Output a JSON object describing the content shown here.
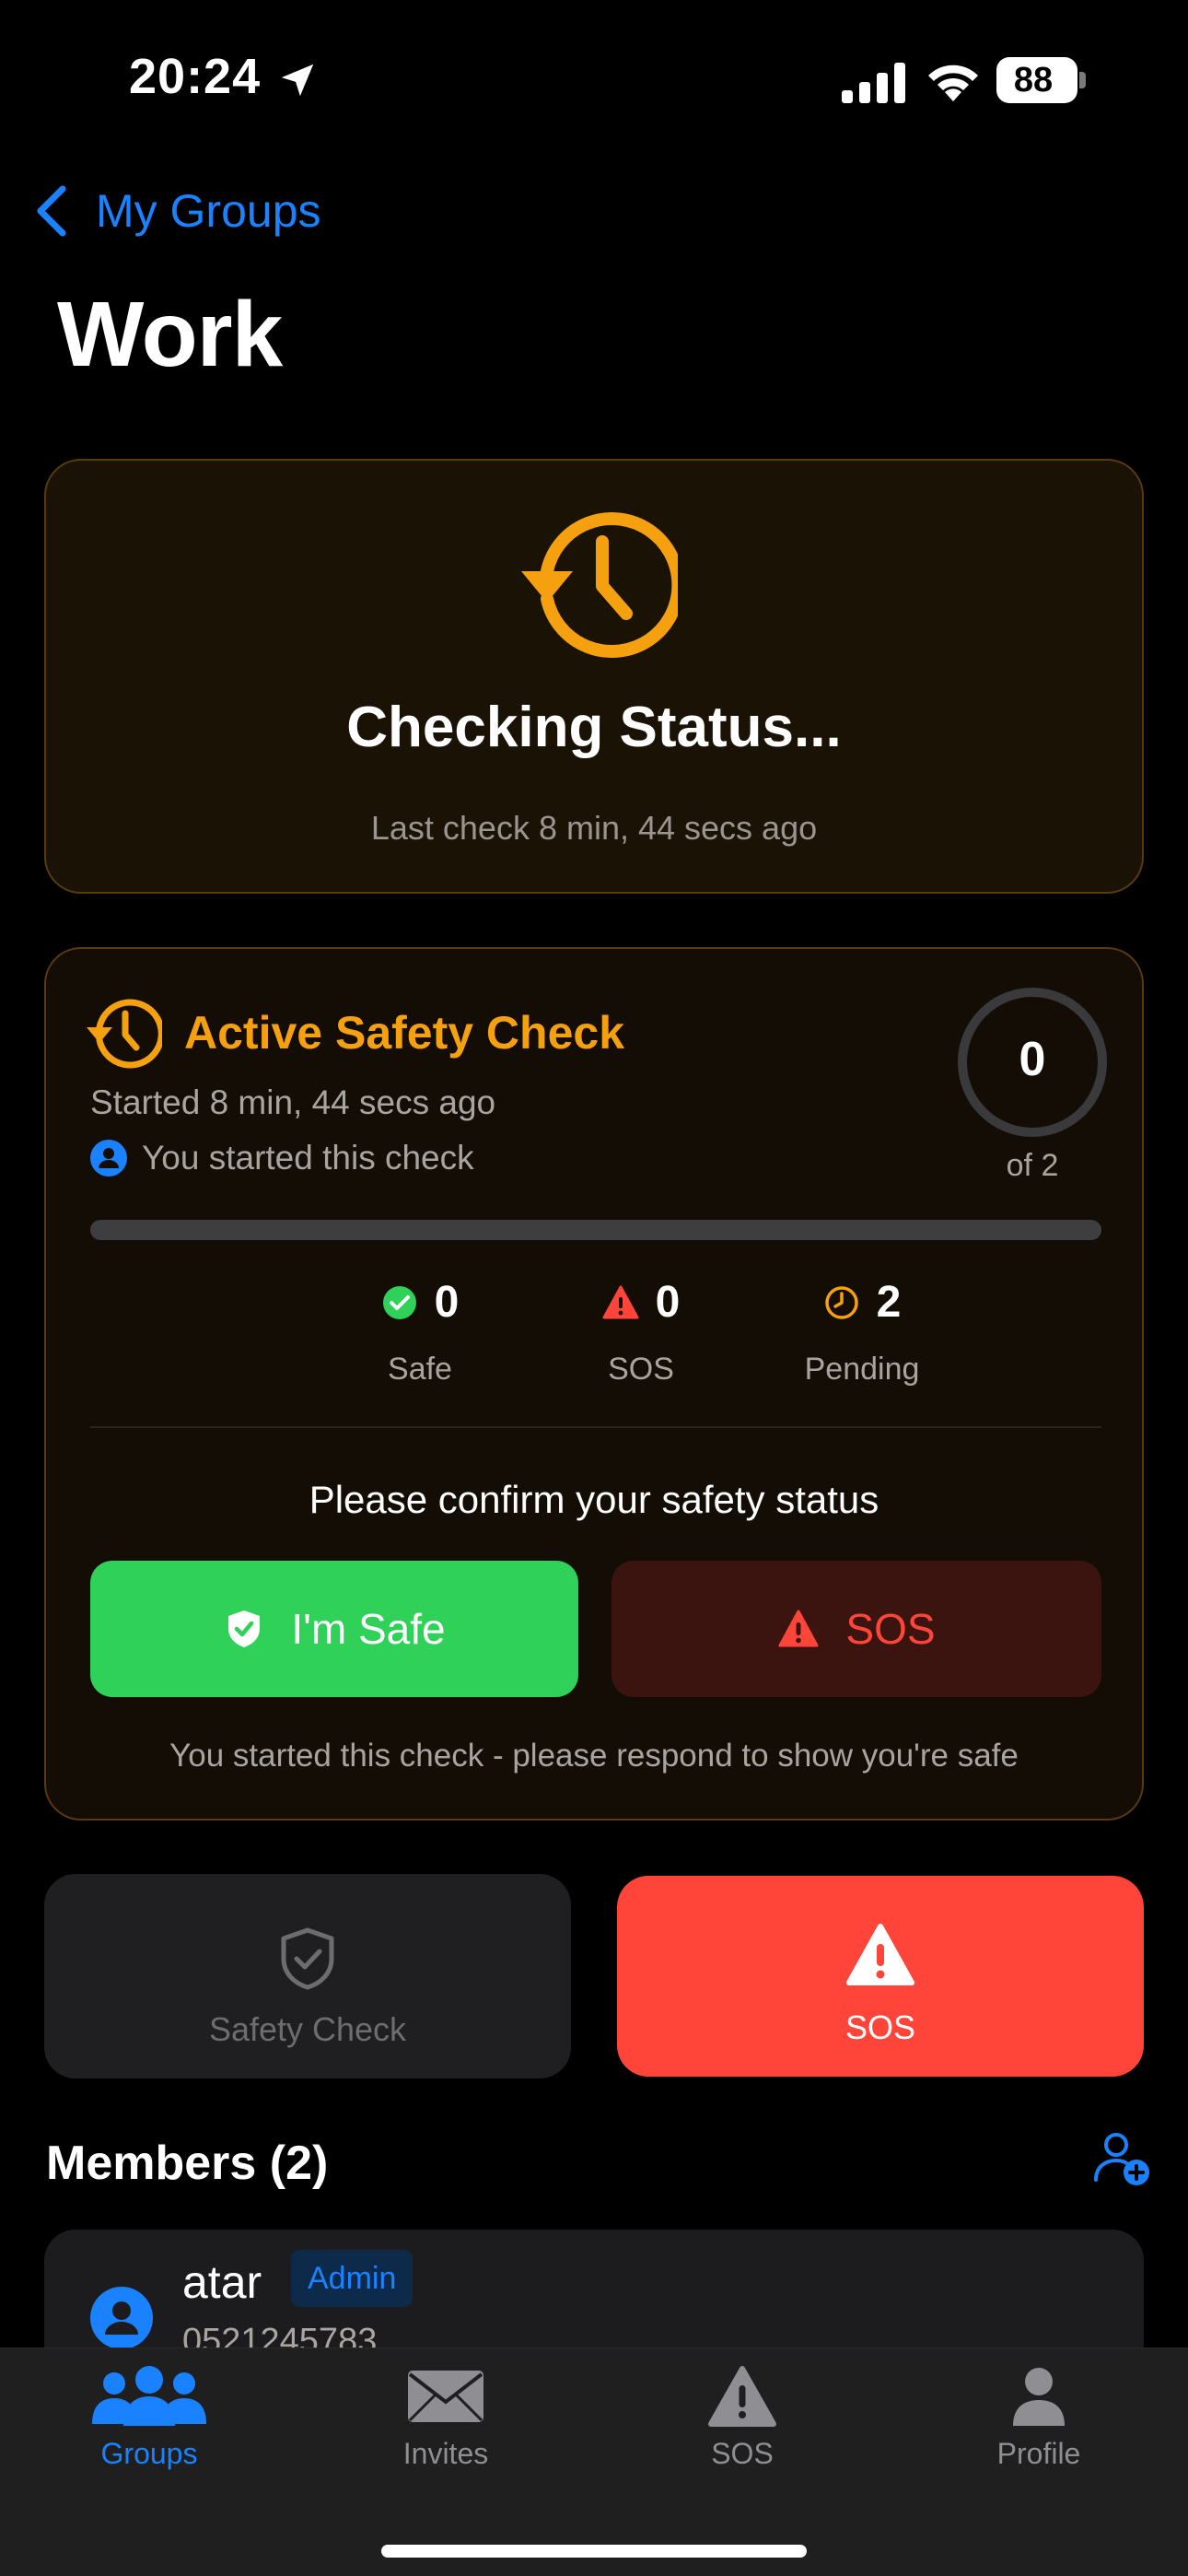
{
  "status_bar": {
    "time": "20:24",
    "battery": "88"
  },
  "nav": {
    "back_label": "My Groups",
    "title": "Work"
  },
  "colors": {
    "accent": "#1a82ff",
    "warning": "#f5a10f",
    "safe": "#30d158",
    "danger": "#ff453a"
  },
  "status_card": {
    "icon": "clock-history-icon",
    "title": "Checking Status...",
    "subtitle": "Last check 8 min, 44 secs ago"
  },
  "active_check": {
    "title": "Active Safety Check",
    "started": "Started 8 min, 44 secs ago",
    "owner_note": "You started this check",
    "responded": "0",
    "responded_of": "of 2",
    "progress_fraction": 0,
    "stats": {
      "safe": {
        "value": "0",
        "label": "Safe"
      },
      "sos": {
        "value": "0",
        "label": "SOS"
      },
      "pending": {
        "value": "2",
        "label": "Pending"
      }
    },
    "confirm_prompt": "Please confirm your safety status",
    "safe_button": "I'm Safe",
    "sos_button": "SOS",
    "hint": "You started this check - please respond to show you're safe"
  },
  "actions": {
    "safety_check_label": "Safety Check",
    "sos_label": "SOS"
  },
  "members": {
    "title": "Members (2)",
    "list": [
      {
        "name": "atar",
        "badge": "Admin",
        "phone": "0521245783"
      }
    ]
  },
  "tabs": [
    {
      "label": "Groups",
      "icon": "people-icon",
      "active": true
    },
    {
      "label": "Invites",
      "icon": "envelope-icon",
      "active": false
    },
    {
      "label": "SOS",
      "icon": "warning-triangle-icon",
      "active": false
    },
    {
      "label": "Profile",
      "icon": "person-icon",
      "active": false
    }
  ]
}
